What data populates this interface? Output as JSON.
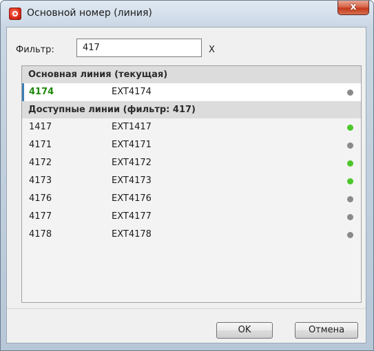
{
  "window": {
    "title": "Основной номер (линия)",
    "close_glyph": "x"
  },
  "filter": {
    "label": "Фильтр:",
    "value": "417",
    "clear_label": "X"
  },
  "groups": {
    "current": {
      "header": "Основная линия (текущая)",
      "rows": [
        {
          "number": "4174",
          "ext": "EXT4174",
          "status": "offline"
        }
      ]
    },
    "available": {
      "header": "Доступные линии (фильтр: 417)",
      "rows": [
        {
          "number": "1417",
          "ext": "EXT1417",
          "status": "online"
        },
        {
          "number": "4171",
          "ext": "EXT4171",
          "status": "offline"
        },
        {
          "number": "4172",
          "ext": "EXT4172",
          "status": "online"
        },
        {
          "number": "4173",
          "ext": "EXT4173",
          "status": "online"
        },
        {
          "number": "4176",
          "ext": "EXT4176",
          "status": "offline"
        },
        {
          "number": "4177",
          "ext": "EXT4177",
          "status": "offline"
        },
        {
          "number": "4178",
          "ext": "EXT4178",
          "status": "offline"
        }
      ]
    }
  },
  "status_colors": {
    "online": "#4cc62b",
    "offline": "#8a8a8a"
  },
  "buttons": {
    "ok_label": "OK",
    "cancel_label": "Отмена"
  }
}
